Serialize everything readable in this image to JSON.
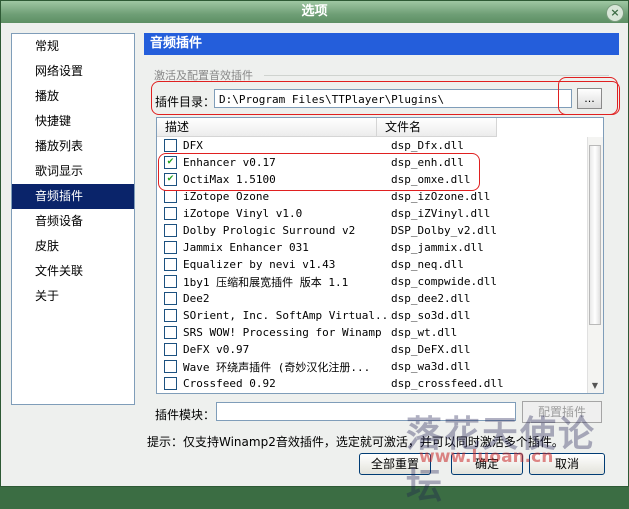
{
  "window": {
    "title": "选项",
    "close_glyph": "×"
  },
  "sidebar": {
    "items": [
      {
        "label": "常规"
      },
      {
        "label": "网络设置"
      },
      {
        "label": "播放"
      },
      {
        "label": "快捷键"
      },
      {
        "label": "播放列表"
      },
      {
        "label": "歌词显示"
      },
      {
        "label": "音频插件",
        "active": true
      },
      {
        "label": "音频设备"
      },
      {
        "label": "皮肤"
      },
      {
        "label": "文件关联"
      },
      {
        "label": "关于"
      }
    ]
  },
  "panel": {
    "header": "音频插件",
    "group_label": "激活及配置音效插件",
    "dir_label": "插件目录：",
    "dir_value": "D:\\Program Files\\TTPlayer\\Plugins\\",
    "browse_label": "...",
    "columns": [
      "描述",
      "文件名"
    ],
    "plugins": [
      {
        "name": "DFX",
        "file": "dsp_Dfx.dll",
        "checked": false
      },
      {
        "name": "Enhancer v0.17",
        "file": "dsp_enh.dll",
        "checked": true
      },
      {
        "name": "OctiMax 1.5100",
        "file": "dsp_omxe.dll",
        "checked": true
      },
      {
        "name": "iZotope Ozone",
        "file": "dsp_izOzone.dll",
        "checked": false
      },
      {
        "name": "iZotope Vinyl v1.0",
        "file": "dsp_iZVinyl.dll",
        "checked": false
      },
      {
        "name": "Dolby Prologic Surround v2",
        "file": "DSP_Dolby_v2.dll",
        "checked": false
      },
      {
        "name": "Jammix Enhancer 031",
        "file": "dsp_jammix.dll",
        "checked": false
      },
      {
        "name": "Equalizer by nevi v1.43",
        "file": "dsp_neq.dll",
        "checked": false
      },
      {
        "name": "1by1 压缩和展宽插件 版本 1.1",
        "file": "dsp_compwide.dll",
        "checked": false
      },
      {
        "name": "Dee2",
        "file": "dsp_dee2.dll",
        "checked": false
      },
      {
        "name": "SOrient, Inc. SoftAmp Virtual...",
        "file": "dsp_so3d.dll",
        "checked": false
      },
      {
        "name": "SRS WOW! Processing for Winamp",
        "file": "dsp_wt.dll",
        "checked": false
      },
      {
        "name": "DeFX v0.97",
        "file": "dsp_DeFX.dll",
        "checked": false
      },
      {
        "name": "Wave 环绕声插件 (奇妙汉化注册...",
        "file": "dsp_wa3d.dll",
        "checked": false
      },
      {
        "name": "Crossfeed 0.92",
        "file": "dsp_crossfeed.dll",
        "checked": false
      }
    ],
    "module_label": "插件模块：",
    "config_label": "配置插件"
  },
  "hint": "提示：仅支持Winamp2音效插件，选定就可激活，并可以同时激活多个插件。",
  "buttons": {
    "reset": "全部重置",
    "ok": "确定",
    "cancel": "取消"
  },
  "watermark": {
    "text": "落花天使论坛",
    "url": "www.luoan.cn"
  }
}
